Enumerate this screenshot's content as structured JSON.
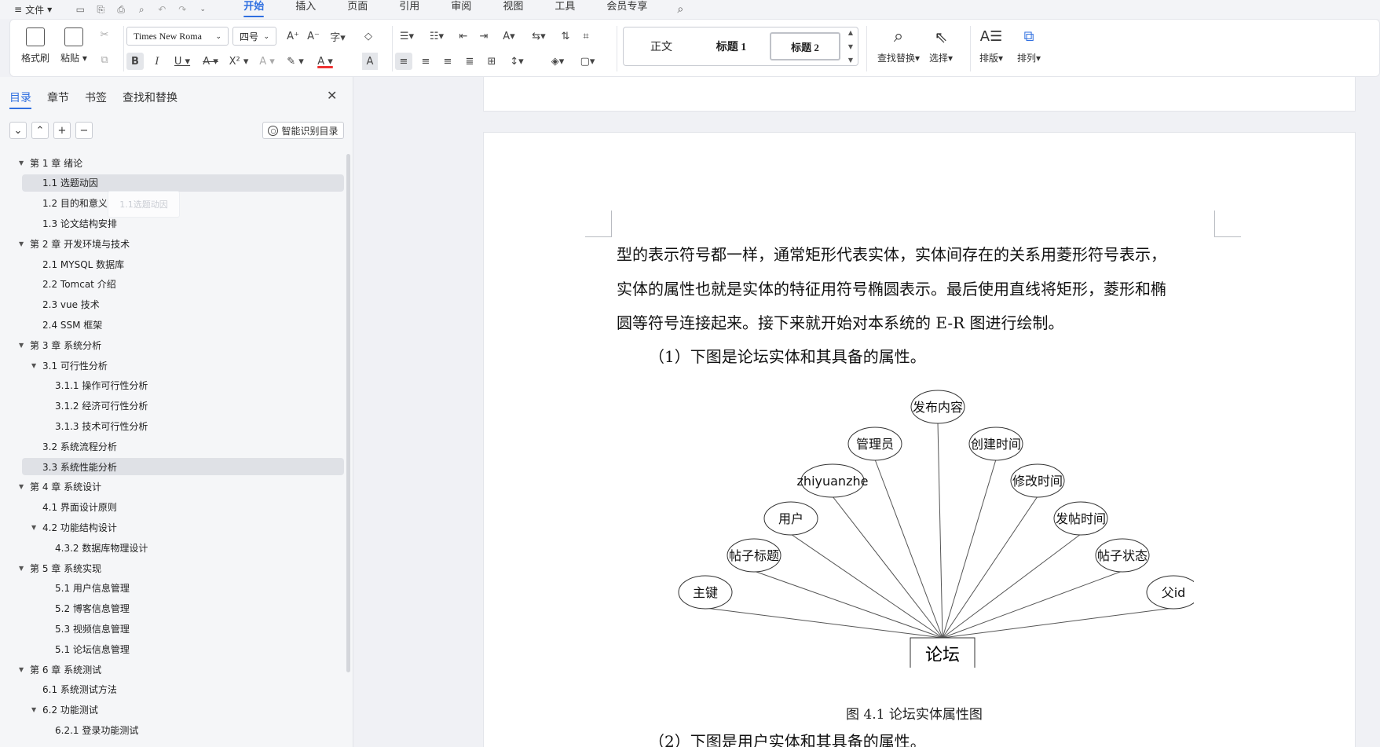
{
  "menubar": {
    "file": "文件",
    "tabs": [
      "开始",
      "插入",
      "页面",
      "引用",
      "审阅",
      "视图",
      "工具",
      "会员专享"
    ],
    "active_tab": "开始"
  },
  "ribbon": {
    "format_painter": "格式刷",
    "paste": "粘贴",
    "font_name": "Times New Roma",
    "font_size": "四号",
    "styles": [
      "正文",
      "标题 1",
      "标题 2"
    ],
    "find_replace": "查找替换",
    "select": "选择",
    "layout": "排版",
    "arrange": "排列"
  },
  "panel": {
    "tabs": [
      "目录",
      "章节",
      "书签",
      "查找和替换"
    ],
    "active_tab": "目录",
    "smart_toc": "智能识别目录",
    "drag_ghost": "1.1选题动因",
    "toc": [
      {
        "text": "第 1 章  绪论",
        "level": 1,
        "expanded": true
      },
      {
        "text": "1.1 选题动因",
        "level": 2,
        "highlight": true
      },
      {
        "text": "1.2 目的和意义",
        "level": 2
      },
      {
        "text": "1.3 论文结构安排",
        "level": 2
      },
      {
        "text": "第 2 章  开发环境与技术",
        "level": 1,
        "expanded": true
      },
      {
        "text": "2.1 MYSQL 数据库",
        "level": 2
      },
      {
        "text": "2.2 Tomcat  介绍",
        "level": 2
      },
      {
        "text": "2.3 vue 技术",
        "level": 2
      },
      {
        "text": "2.4 SSM 框架",
        "level": 2
      },
      {
        "text": "第 3 章  系统分析",
        "level": 1,
        "expanded": true
      },
      {
        "text": "3.1 可行性分析",
        "level": 2,
        "expanded": true
      },
      {
        "text": "3.1.1 操作可行性分析",
        "level": 3
      },
      {
        "text": "3.1.2 经济可行性分析",
        "level": 3
      },
      {
        "text": "3.1.3 技术可行性分析",
        "level": 3
      },
      {
        "text": "3.2 系统流程分析",
        "level": 2
      },
      {
        "text": "3.3 系统性能分析",
        "level": 2,
        "highlight": true
      },
      {
        "text": "第 4 章  系统设计",
        "level": 1,
        "expanded": true
      },
      {
        "text": "4.1 界面设计原则",
        "level": 2
      },
      {
        "text": "4.2 功能结构设计",
        "level": 2,
        "expanded": true
      },
      {
        "text": "4.3.2  数据库物理设计",
        "level": 3
      },
      {
        "text": "第 5 章  系统实现",
        "level": 1,
        "expanded": true
      },
      {
        "text": "5.1 用户信息管理",
        "level": 3
      },
      {
        "text": "5.2  博客信息管理",
        "level": 3
      },
      {
        "text": "5.3 视频信息管理",
        "level": 3
      },
      {
        "text": "5.1 论坛信息管理",
        "level": 3
      },
      {
        "text": "第 6 章  系统测试",
        "level": 1,
        "expanded": true
      },
      {
        "text": "6.1  系统测试方法",
        "level": 2
      },
      {
        "text": "6.2  功能测试",
        "level": 2,
        "expanded": true
      },
      {
        "text": "6.2.1  登录功能测试",
        "level": 3
      }
    ]
  },
  "document": {
    "lines": [
      "型的表示符号都一样，通常矩形代表实体，实体间存在的关系用菱形符号表示，",
      "实体的属性也就是实体的特征用符号椭圆表示。最后使用直线将矩形，菱形和椭",
      "圆等符号连接起来。接下来就开始对本系统的 E-R 图进行绘制。",
      "（1）下图是论坛实体和其具备的属性。"
    ],
    "er": {
      "entity": "论坛",
      "attributes": [
        "主键",
        "帖子标题",
        "用户",
        "zhiyuanzhe",
        "管理员",
        "发布内容",
        "创建时间",
        "修改时间",
        "发帖时间",
        "帖子状态",
        "父id"
      ]
    },
    "caption": "图 4.1  论坛实体属性图",
    "next_line": "（2）下图是用户实体和其具备的属性。"
  }
}
